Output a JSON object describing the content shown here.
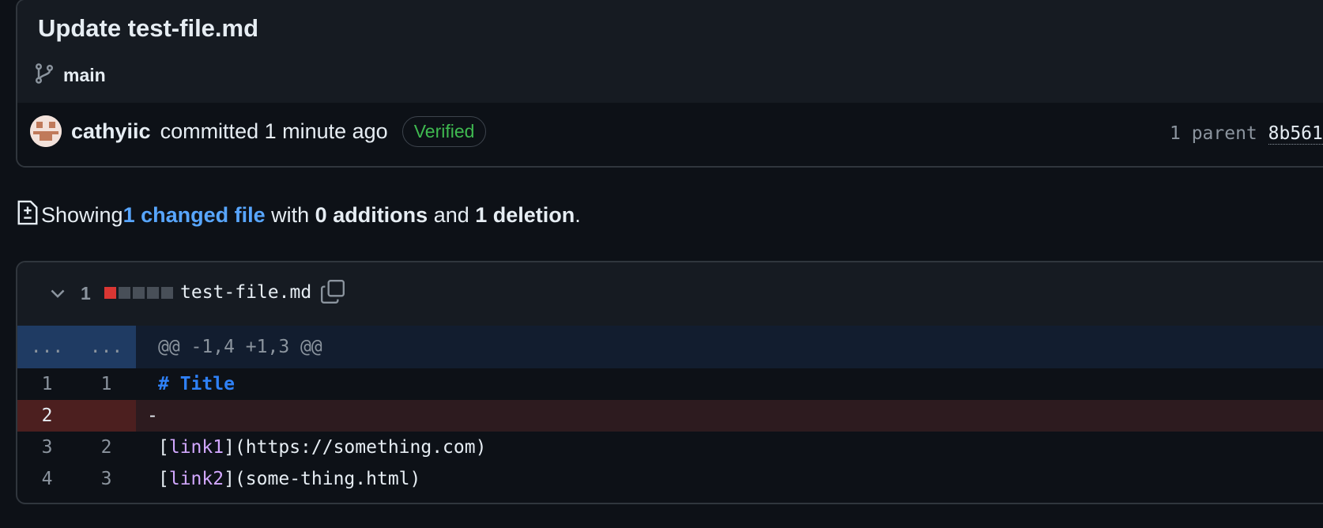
{
  "commit": {
    "title": "Update test-file.md",
    "branch": "main",
    "author": "cathyiic",
    "action": "committed 1 minute ago",
    "verified_label": "Verified",
    "parent_label": "1 parent",
    "parent_sha": "8b561"
  },
  "summary": {
    "prefix": "Showing ",
    "changed_files": "1 changed file",
    "with": " with ",
    "additions": "0 additions",
    "and": " and ",
    "deletions": "1 deletion",
    "suffix": "."
  },
  "file": {
    "change_count": "1",
    "name": "test-file.md",
    "diffstat": [
      "deleted",
      "neutral",
      "neutral",
      "neutral",
      "neutral"
    ]
  },
  "diff": {
    "hunk": {
      "old": "...",
      "new": "...",
      "text": "@@ -1,4 +1,3 @@"
    },
    "lines": [
      {
        "old": "1",
        "new": "1",
        "type": "context",
        "marker": "",
        "prefix": "",
        "heading": "# Title",
        "link": "",
        "rest": ""
      },
      {
        "old": "2",
        "new": "",
        "type": "deletion",
        "marker": "-",
        "prefix": "",
        "heading": "",
        "link": "",
        "rest": ""
      },
      {
        "old": "3",
        "new": "2",
        "type": "context",
        "marker": "",
        "prefix": "[",
        "heading": "",
        "link": "link1",
        "rest": "](https://something.com)"
      },
      {
        "old": "4",
        "new": "3",
        "type": "context",
        "marker": "",
        "prefix": "[",
        "heading": "",
        "link": "link2",
        "rest": "](some-thing.html)"
      }
    ]
  },
  "colors": {
    "background": "#0d1117",
    "accent": "#58a6ff",
    "verified": "#3fb950",
    "deletion": "#da3633"
  }
}
